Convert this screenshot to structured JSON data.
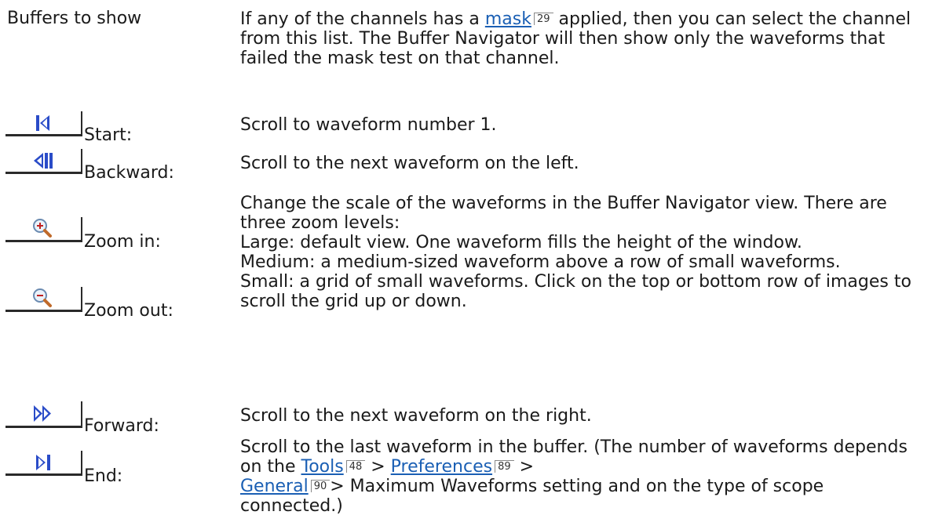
{
  "rows": [
    {
      "label": "Buffers to show",
      "desc_parts": {
        "before": "If any of the channels has a ",
        "link": "mask",
        "ref": "29",
        "after": " applied, then you can select the channel from this list. The Buffer Navigator will then show only the waveforms that failed the mask test on that channel."
      }
    },
    {
      "label": "Start:",
      "icon": "start-icon",
      "desc": "Scroll to waveform number 1."
    },
    {
      "label": "Backward:",
      "icon": "backward-icon",
      "desc": "Scroll to the next waveform on the left."
    },
    {
      "label": "Zoom in:",
      "icon": "zoom-in-icon",
      "desc_lines": [
        "Change the scale of the waveforms in the Buffer Navigator view. There are three zoom levels:",
        "Large: default view. One waveform fills the height of the window.",
        "Medium: a medium-sized waveform above a row of small waveforms.",
        "Small: a grid of small waveforms. Click on the top or bottom row of images to scroll the grid up or down."
      ]
    },
    {
      "label": "Zoom out:",
      "icon": "zoom-out-icon"
    },
    {
      "label": "Forward:",
      "icon": "forward-icon",
      "desc": "Scroll to the next waveform on the right."
    },
    {
      "label": "End:",
      "icon": "end-icon",
      "desc_parts": {
        "before": "Scroll to the last waveform in the buffer. (The number of waveforms depends on the ",
        "link1": "Tools",
        "ref1": "48",
        "sep1": " > ",
        "link2": "Preferences",
        "ref2": "89",
        "sep2": " > ",
        "link3": "General",
        "ref3": "90",
        "after": "> Maximum Waveforms setting and on the type of scope connected.)"
      }
    }
  ],
  "colors": {
    "link": "#1a5fb4",
    "icon_blue": "#2a4cc8",
    "text": "#1a1a1a"
  }
}
